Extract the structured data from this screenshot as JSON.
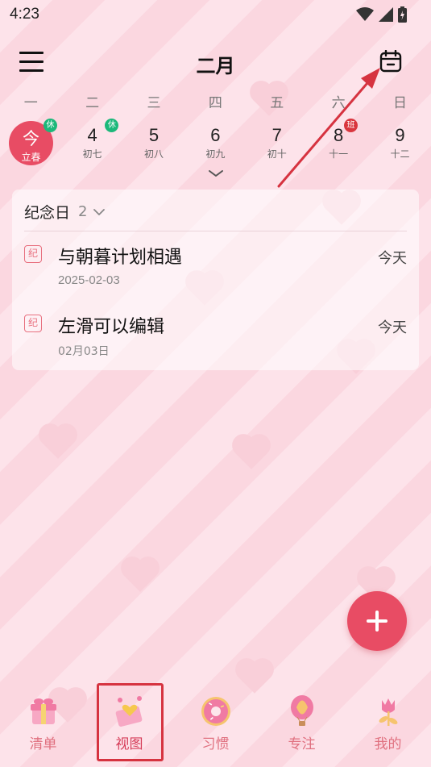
{
  "status_bar": {
    "time": "4:23"
  },
  "header": {
    "title": "二月"
  },
  "weekdays": [
    "一",
    "二",
    "三",
    "四",
    "五",
    "六",
    "日"
  ],
  "days": [
    {
      "num": "今",
      "lunar": "立春",
      "badge": "休",
      "badge_color": "#1cb87a",
      "today": true
    },
    {
      "num": "4",
      "lunar": "初七",
      "badge": "休",
      "badge_color": "#1cb87a"
    },
    {
      "num": "5",
      "lunar": "初八"
    },
    {
      "num": "6",
      "lunar": "初九"
    },
    {
      "num": "7",
      "lunar": "初十"
    },
    {
      "num": "8",
      "lunar": "十一",
      "badge": "班",
      "badge_color": "#d9363e"
    },
    {
      "num": "9",
      "lunar": "十二"
    }
  ],
  "card": {
    "title": "纪念日",
    "count": "2",
    "events": [
      {
        "tag": "纪",
        "title": "与朝暮计划相遇",
        "date": "2025-02-03",
        "when": "今天"
      },
      {
        "tag": "纪",
        "title": "左滑可以编辑",
        "date": "02月03日",
        "when": "今天"
      }
    ]
  },
  "tabs": [
    {
      "label": "清单",
      "icon": "gift-icon"
    },
    {
      "label": "视图",
      "icon": "envelope-heart-icon",
      "active": true
    },
    {
      "label": "习惯",
      "icon": "donut-icon"
    },
    {
      "label": "专注",
      "icon": "hot-air-balloon-icon"
    },
    {
      "label": "我的",
      "icon": "tulip-icon"
    }
  ],
  "colors": {
    "accent": "#e84c64",
    "tab_label": "#e0707f",
    "annotation": "#d63340",
    "holiday_badge": "#1cb87a",
    "workday_badge": "#d9363e"
  }
}
